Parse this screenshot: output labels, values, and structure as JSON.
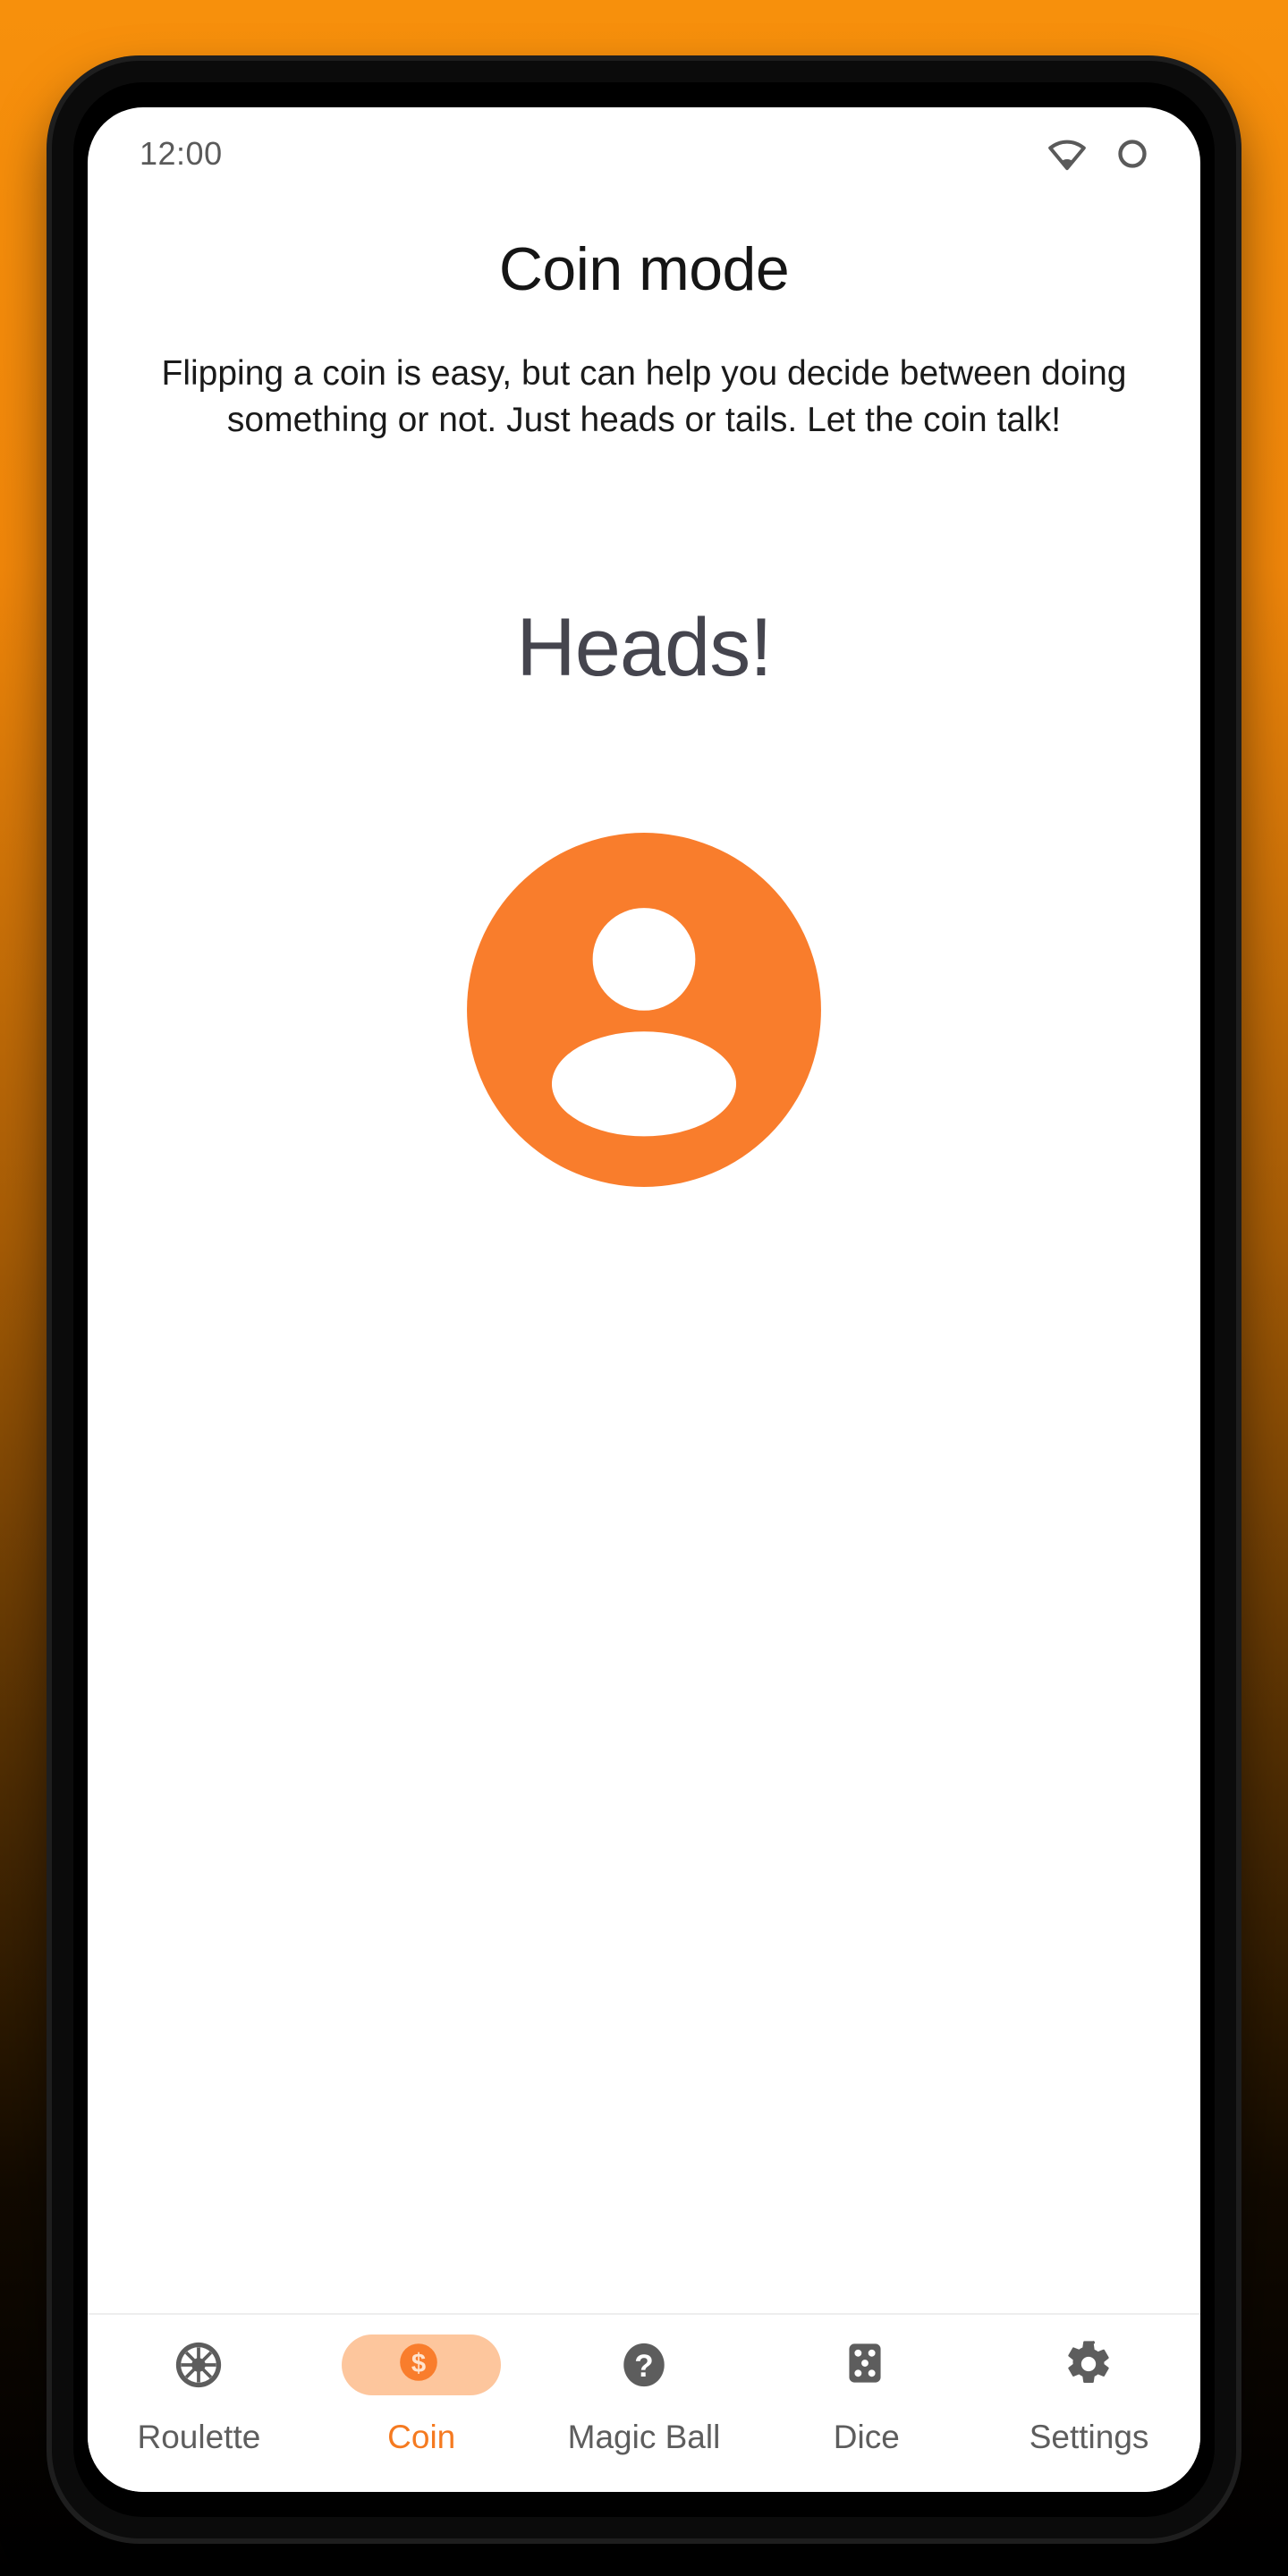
{
  "status_bar": {
    "time": "12:00",
    "icons": [
      "wifi-icon",
      "battery-circle-icon"
    ]
  },
  "screen": {
    "title": "Coin mode",
    "description": "Flipping a coin is easy, but can help you decide between doing something or not. Just heads or tails. Let the coin talk!",
    "result": "Heads!",
    "result_art": "coin-heads-person-icon"
  },
  "bottom_nav": {
    "active_index": 1,
    "items": [
      {
        "label": "Roulette",
        "icon": "roulette-wheel-icon"
      },
      {
        "label": "Coin",
        "icon": "coin-dollar-icon"
      },
      {
        "label": "Magic Ball",
        "icon": "question-mark-circle-icon"
      },
      {
        "label": "Dice",
        "icon": "dice-five-icon"
      },
      {
        "label": "Settings",
        "icon": "gear-icon"
      }
    ]
  },
  "colors": {
    "background_top": "#f7900c",
    "background_bottom": "#000000",
    "accent_orange": "#f57a20",
    "coin_orange": "#f97d2c",
    "pill_light_orange": "#fdc69d",
    "result_gray": "#45454e",
    "nav_inactive_gray": "#5d5d5d",
    "status_gray": "#5a5a5a",
    "divider": "#eeeeee"
  }
}
